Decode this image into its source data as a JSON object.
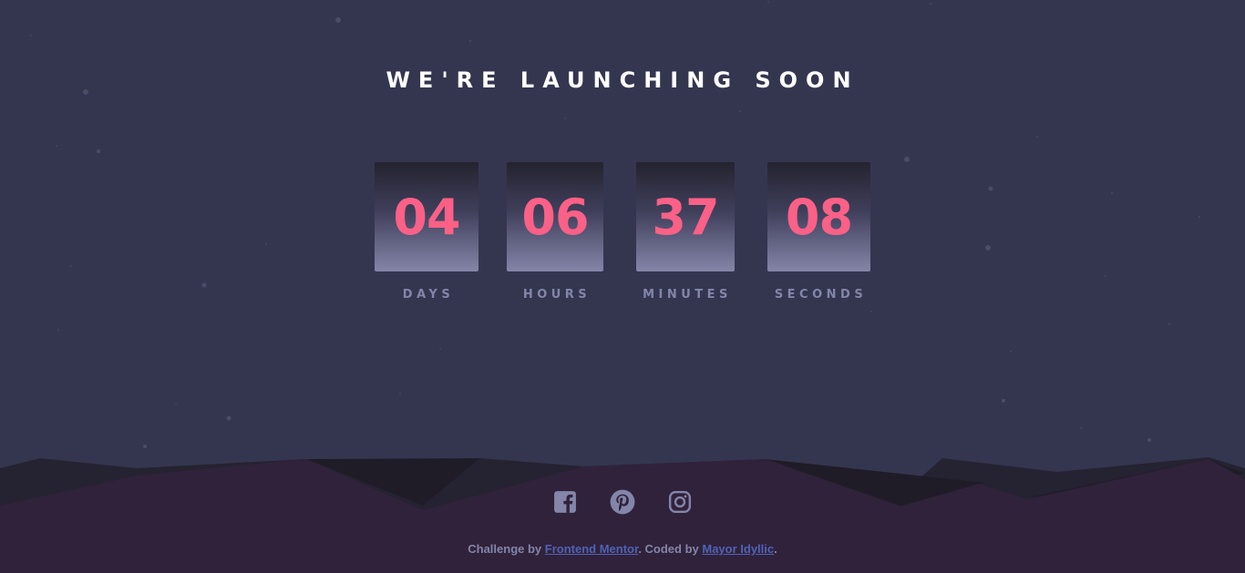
{
  "heading": "WE'RE LAUNCHING SOON",
  "countdown": [
    {
      "value": "04",
      "label": "DAYS"
    },
    {
      "value": "06",
      "label": "HOURS"
    },
    {
      "value": "37",
      "label": "MINUTES"
    },
    {
      "value": "08",
      "label": "SECONDS"
    }
  ],
  "social": [
    {
      "name": "facebook",
      "icon": "facebook-icon"
    },
    {
      "name": "pinterest",
      "icon": "pinterest-icon"
    },
    {
      "name": "instagram",
      "icon": "instagram-icon"
    }
  ],
  "footer": {
    "prefix": "Challenge by ",
    "link1": "Frontend Mentor",
    "middle": ". Coded by ",
    "link2": "Mayor Idyllic",
    "suffix": "."
  },
  "colors": {
    "background": "#343650",
    "accent": "#fb6087",
    "muted": "#8385a9",
    "hills": "#30223a",
    "link": "#4f62b7"
  }
}
